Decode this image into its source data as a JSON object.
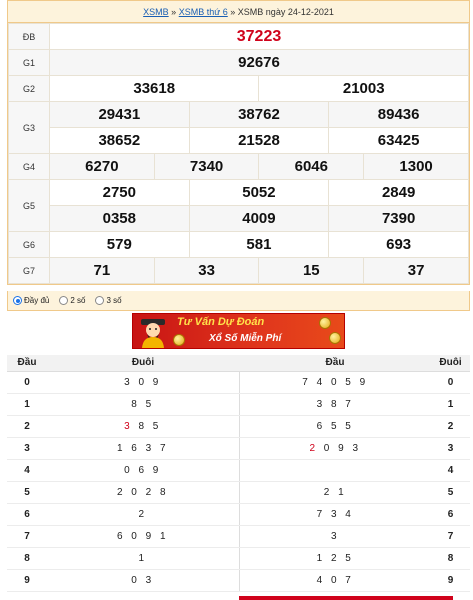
{
  "breadcrumb": {
    "link1": "XSMB",
    "sep1": "»",
    "link2": "XSMB thứ 6",
    "sep2": "»",
    "current": "XSMB ngày 24-12-2021"
  },
  "prizes": {
    "db": {
      "label": "ĐB",
      "values": [
        "37223"
      ]
    },
    "g1": {
      "label": "G1",
      "values": [
        "92676"
      ]
    },
    "g2": {
      "label": "G2",
      "values": [
        "33618",
        "21003"
      ]
    },
    "g3": {
      "label": "G3",
      "values": [
        "29431",
        "38762",
        "89436",
        "38652",
        "21528",
        "63425"
      ]
    },
    "g4": {
      "label": "G4",
      "values": [
        "6270",
        "7340",
        "6046",
        "1300"
      ]
    },
    "g5": {
      "label": "G5",
      "values": [
        "2750",
        "5052",
        "2849",
        "0358",
        "4009",
        "7390"
      ]
    },
    "g6": {
      "label": "G6",
      "values": [
        "579",
        "581",
        "693"
      ]
    },
    "g7": {
      "label": "G7",
      "values": [
        "71",
        "33",
        "15",
        "37"
      ]
    }
  },
  "display_options": [
    {
      "label": "Đầy đủ",
      "selected": true
    },
    {
      "label": "2 số",
      "selected": false
    },
    {
      "label": "3 số",
      "selected": false
    }
  ],
  "banner": {
    "line1": "Tư Vấn Dự Đoán",
    "line2": "Xổ Số Miễn Phí"
  },
  "loto": {
    "headers": [
      "Đầu",
      "Đuôi",
      "Đầu",
      "Đuôi"
    ],
    "rows": [
      {
        "head": "0",
        "tails": "3 0 9",
        "heads": "7 4 0 5 9",
        "tail": "0"
      },
      {
        "head": "1",
        "tails": "8 5",
        "heads": "3 8 7",
        "tail": "1"
      },
      {
        "head": "2",
        "tails_red": "3",
        "tails": " 8 5",
        "heads": "6 5 5",
        "tail": "2"
      },
      {
        "head": "3",
        "tails": "1 6 3 7",
        "heads_red": "2",
        "heads": " 0 9 3",
        "tail": "3"
      },
      {
        "head": "4",
        "tails": "0 6 9",
        "heads": "",
        "tail": "4"
      },
      {
        "head": "5",
        "tails": "2 0 2 8",
        "heads": "2 1",
        "tail": "5"
      },
      {
        "head": "6",
        "tails": "2",
        "heads": "7 3 4",
        "tail": "6"
      },
      {
        "head": "7",
        "tails": "6 0 9 1",
        "heads": "3",
        "tail": "7"
      },
      {
        "head": "8",
        "tails": "1",
        "heads": "1 2 5",
        "tail": "8"
      },
      {
        "head": "9",
        "tails": "0 3",
        "heads": "4 0 7",
        "tail": "9"
      }
    ]
  },
  "colors": {
    "special_prize": "#d0021b",
    "link": "#1a5fb4",
    "header_bg": "#fdf3dc"
  }
}
